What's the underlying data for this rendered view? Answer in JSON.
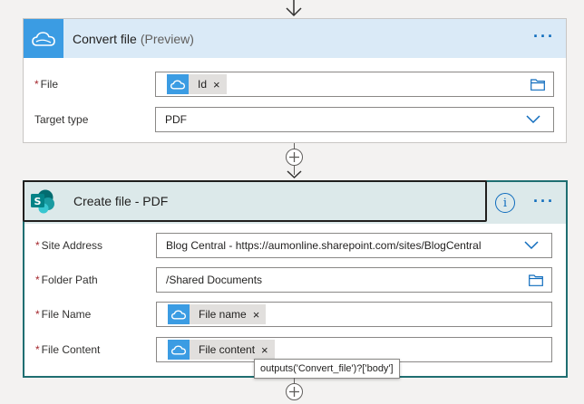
{
  "convert_file": {
    "title": "Convert file",
    "subtitle": "(Preview)",
    "more_label": "···",
    "fields": {
      "file": {
        "label": "File",
        "required_mark": "*",
        "token": "Id",
        "token_remove": "×"
      },
      "target_type": {
        "label": "Target type",
        "value": "PDF"
      }
    }
  },
  "create_file": {
    "title": "Create file - PDF",
    "info_label": "i",
    "more_label": "···",
    "fields": {
      "site_address": {
        "label": "Site Address",
        "required_mark": "*",
        "value": "Blog Central - https://aumonline.sharepoint.com/sites/BlogCentral"
      },
      "folder_path": {
        "label": "Folder Path",
        "required_mark": "*",
        "value": "/Shared Documents"
      },
      "file_name": {
        "label": "File Name",
        "required_mark": "*",
        "token": "File name",
        "token_remove": "×"
      },
      "file_content": {
        "label": "File Content",
        "required_mark": "*",
        "token": "File content",
        "token_remove": "×"
      }
    }
  },
  "tooltip": {
    "text": "outputs('Convert_file')?['body']"
  },
  "icons": {
    "arrow": "down-arrow-icon",
    "add": "plus-icon",
    "onedrive": "onedrive-cloud-icon",
    "sharepoint": "sharepoint-icon",
    "chevron": "chevron-down-icon",
    "folder": "folder-icon"
  },
  "colors": {
    "accent": "#0f6cbd",
    "onedrive_blue": "#3b9ce3",
    "sharepoint_teal": "#036c70",
    "required_red": "#a4262c"
  }
}
